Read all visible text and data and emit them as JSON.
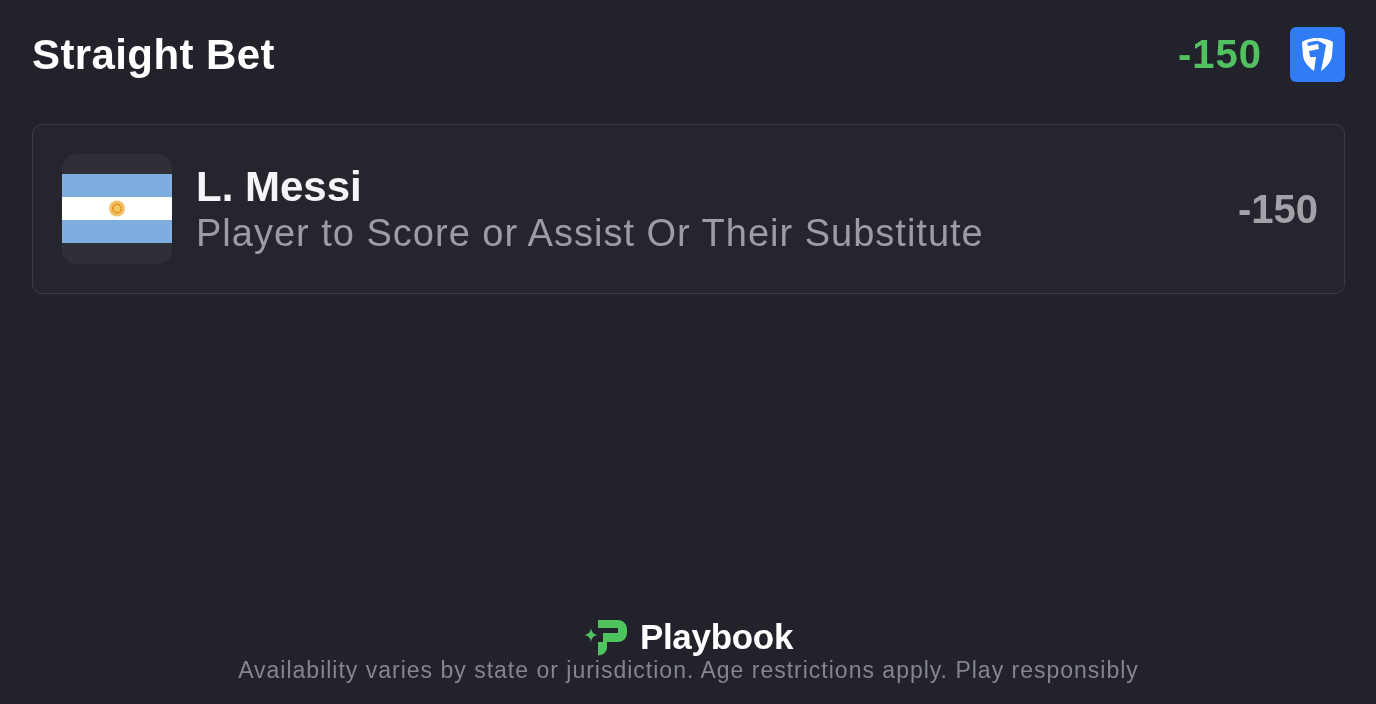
{
  "header": {
    "title": "Straight Bet",
    "odds": "-150"
  },
  "selection": {
    "player": "L. Messi",
    "market": "Player to Score or Assist Or Their Substitute",
    "odds": "-150"
  },
  "footer": {
    "brand": "Playbook",
    "disclaimer": "Availability varies by state or jurisdiction. Age restrictions apply. Play responsibly"
  }
}
